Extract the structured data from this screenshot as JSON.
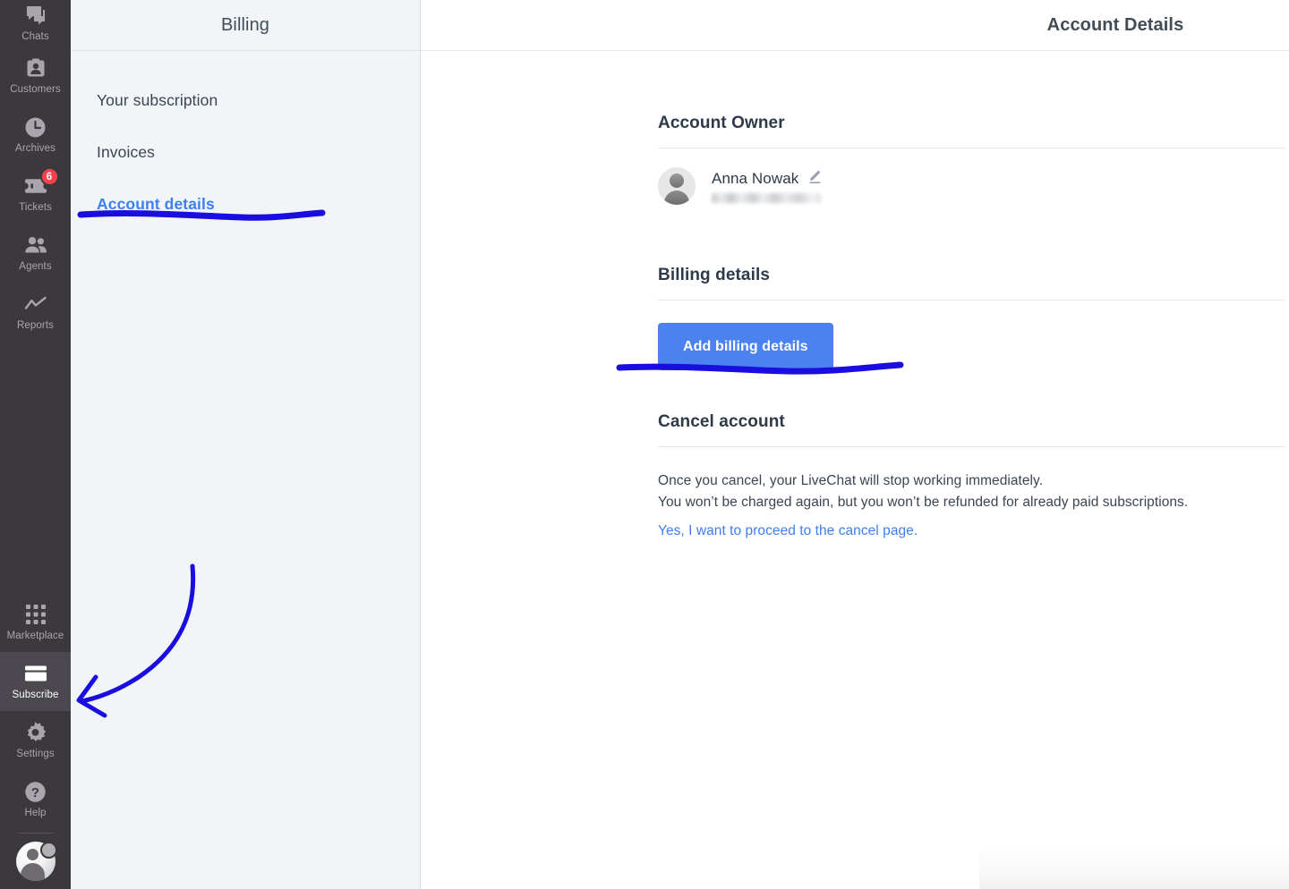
{
  "nav": {
    "items": [
      {
        "label": "Chats",
        "icon": "chats-icon",
        "badge": null,
        "active": false
      },
      {
        "label": "Customers",
        "icon": "customers-icon",
        "badge": null,
        "active": false
      },
      {
        "label": "Archives",
        "icon": "archives-icon",
        "badge": null,
        "active": false
      },
      {
        "label": "Tickets",
        "icon": "tickets-icon",
        "badge": "6",
        "active": false
      },
      {
        "label": "Agents",
        "icon": "agents-icon",
        "badge": null,
        "active": false
      },
      {
        "label": "Reports",
        "icon": "reports-icon",
        "badge": null,
        "active": false
      }
    ],
    "bottom_items": [
      {
        "label": "Marketplace",
        "icon": "marketplace-icon",
        "active": false
      },
      {
        "label": "Subscribe",
        "icon": "credit-card-icon",
        "active": true
      },
      {
        "label": "Settings",
        "icon": "gear-icon",
        "active": false
      },
      {
        "label": "Help",
        "icon": "help-icon",
        "active": false
      }
    ],
    "badge_color": "#f4424a",
    "rail_bg": "#3b383e",
    "active_bg": "#4c484f",
    "user_avatar": "user-avatar"
  },
  "billing_panel": {
    "title": "Billing",
    "links": [
      {
        "label": "Your subscription",
        "active": false
      },
      {
        "label": "Invoices",
        "active": false
      },
      {
        "label": "Account details",
        "active": true
      }
    ],
    "active_color": "#3c7ff0"
  },
  "main": {
    "header_title": "Account Details",
    "account_owner": {
      "section_title": "Account Owner",
      "name": "Anna Nowak",
      "email": "",
      "email_redacted": true,
      "edit_icon": "pencil-icon",
      "avatar_icon": "person-avatar"
    },
    "billing_details": {
      "section_title": "Billing details",
      "button_label": "Add billing details",
      "button_color": "#4b82f0"
    },
    "cancel_account": {
      "section_title": "Cancel account",
      "line1": "Once you cancel, your LiveChat will stop working immediately.",
      "line2": "You won’t be charged again, but you won’t be refunded for already paid subscriptions.",
      "link_label": "Yes, I want to proceed to the cancel page.",
      "link_color": "#3c7ff0"
    }
  },
  "annotations": {
    "color": "#1a0de0",
    "items": [
      {
        "name": "underline-account-details",
        "type": "underline"
      },
      {
        "name": "underline-add-billing-details",
        "type": "underline"
      },
      {
        "name": "arrow-to-subscribe",
        "type": "arrow"
      }
    ]
  }
}
